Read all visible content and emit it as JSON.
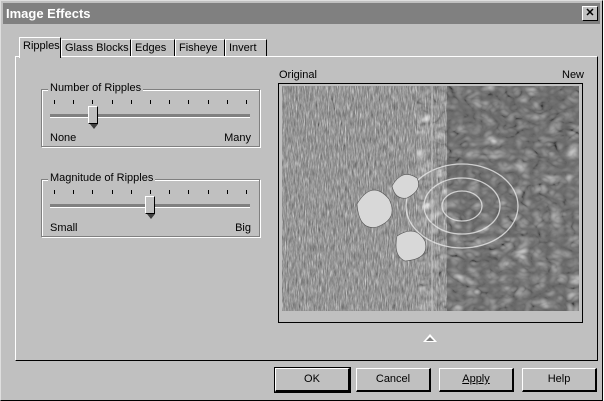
{
  "window": {
    "title": "Image Effects",
    "close_label": "✕"
  },
  "tabs": [
    {
      "label": "Ripples",
      "active": true
    },
    {
      "label": "Glass Blocks",
      "active": false
    },
    {
      "label": "Edges",
      "active": false
    },
    {
      "label": "Fisheye",
      "active": false
    },
    {
      "label": "Invert",
      "active": false
    }
  ],
  "ripples_group": {
    "legend": "Number of Ripples",
    "min_label": "None",
    "max_label": "Many",
    "value_fraction": 0.2
  },
  "magnitude_group": {
    "legend": "Magnitude of Ripples",
    "min_label": "Small",
    "max_label": "Big",
    "value_fraction": 0.5
  },
  "preview": {
    "original_label": "Original",
    "new_label": "New"
  },
  "buttons": {
    "ok": "OK",
    "cancel": "Cancel",
    "apply": "Apply",
    "help": "Help"
  }
}
